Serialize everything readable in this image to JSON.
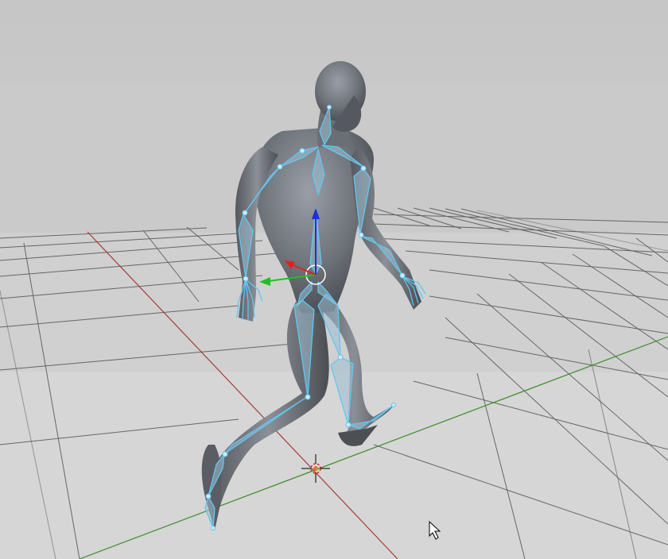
{
  "viewport": {
    "background_top": "#c9c9c9",
    "background_bottom": "#d2d2d2",
    "grid_color": "#5e5e5e",
    "axis_x_color": "#b03030",
    "axis_y_color": "#3f8f2a"
  },
  "armature": {
    "bone_color": "#69c7ef",
    "bone_fill": "#9dbdcc"
  },
  "gizmo": {
    "x_color": "#e02020",
    "y_color": "#20c020",
    "z_color": "#2030d0"
  },
  "icons": [
    "3d-cursor-icon",
    "mouse-pointer-icon"
  ]
}
